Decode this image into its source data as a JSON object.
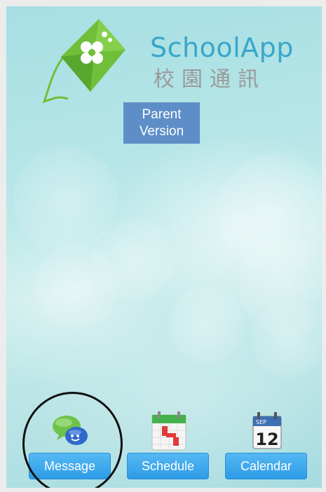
{
  "app": {
    "title": "SchoolApp",
    "subtitle": "校園通訊",
    "version_line1": "Parent",
    "version_line2": "Version"
  },
  "nav": [
    {
      "label": "Message",
      "icon": "message-bubbles-icon"
    },
    {
      "label": "Schedule",
      "icon": "schedule-calendar-icon"
    },
    {
      "label": "Calendar",
      "icon": "calendar-date-icon"
    }
  ],
  "calendar_icon": {
    "month": "SEP",
    "day": "12"
  },
  "colors": {
    "title": "#3aa6c9",
    "subtitle": "#9a9a9a",
    "badge": "#5d8ec8",
    "button": "#3aa8ee",
    "kite_green": "#6fbf3a"
  }
}
